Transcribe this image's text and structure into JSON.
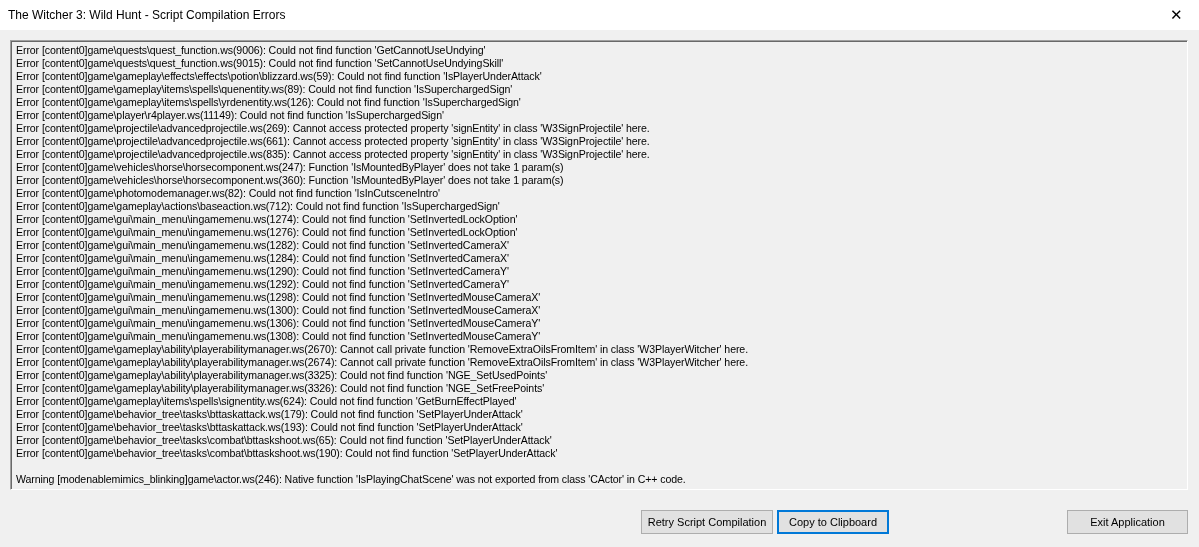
{
  "window": {
    "title": "The Witcher 3: Wild Hunt - Script Compilation Errors",
    "close": "✕"
  },
  "log": {
    "errors": [
      "Error [content0]game\\quests\\quest_function.ws(9006): Could not find function 'GetCannotUseUndying'",
      "Error [content0]game\\quests\\quest_function.ws(9015): Could not find function 'SetCannotUseUndyingSkill'",
      "Error [content0]game\\gameplay\\effects\\effects\\potion\\blizzard.ws(59): Could not find function 'IsPlayerUnderAttack'",
      "Error [content0]game\\gameplay\\items\\spells\\quenentity.ws(89): Could not find function 'IsSuperchargedSign'",
      "Error [content0]game\\gameplay\\items\\spells\\yrdenentity.ws(126): Could not find function 'IsSuperchargedSign'",
      "Error [content0]game\\player\\r4player.ws(11149): Could not find function 'IsSuperchargedSign'",
      "Error [content0]game\\projectile\\advancedprojectile.ws(269): Cannot access protected property 'signEntity' in class 'W3SignProjectile' here.",
      "Error [content0]game\\projectile\\advancedprojectile.ws(661): Cannot access protected property 'signEntity' in class 'W3SignProjectile' here.",
      "Error [content0]game\\projectile\\advancedprojectile.ws(835): Cannot access protected property 'signEntity' in class 'W3SignProjectile' here.",
      "Error [content0]game\\vehicles\\horse\\horsecomponent.ws(247): Function 'IsMountedByPlayer' does not take 1 param(s)",
      "Error [content0]game\\vehicles\\horse\\horsecomponent.ws(360): Function 'IsMountedByPlayer' does not take 1 param(s)",
      "Error [content0]game\\photomodemanager.ws(82): Could not find function 'IsInCutsceneIntro'",
      "Error [content0]game\\gameplay\\actions\\baseaction.ws(712): Could not find function 'IsSuperchargedSign'",
      "Error [content0]game\\gui\\main_menu\\ingamemenu.ws(1274): Could not find function 'SetInvertedLockOption'",
      "Error [content0]game\\gui\\main_menu\\ingamemenu.ws(1276): Could not find function 'SetInvertedLockOption'",
      "Error [content0]game\\gui\\main_menu\\ingamemenu.ws(1282): Could not find function 'SetInvertedCameraX'",
      "Error [content0]game\\gui\\main_menu\\ingamemenu.ws(1284): Could not find function 'SetInvertedCameraX'",
      "Error [content0]game\\gui\\main_menu\\ingamemenu.ws(1290): Could not find function 'SetInvertedCameraY'",
      "Error [content0]game\\gui\\main_menu\\ingamemenu.ws(1292): Could not find function 'SetInvertedCameraY'",
      "Error [content0]game\\gui\\main_menu\\ingamemenu.ws(1298): Could not find function 'SetInvertedMouseCameraX'",
      "Error [content0]game\\gui\\main_menu\\ingamemenu.ws(1300): Could not find function 'SetInvertedMouseCameraX'",
      "Error [content0]game\\gui\\main_menu\\ingamemenu.ws(1306): Could not find function 'SetInvertedMouseCameraY'",
      "Error [content0]game\\gui\\main_menu\\ingamemenu.ws(1308): Could not find function 'SetInvertedMouseCameraY'",
      "Error [content0]game\\gameplay\\ability\\playerabilitymanager.ws(2670): Cannot call private function 'RemoveExtraOilsFromItem' in class 'W3PlayerWitcher' here.",
      "Error [content0]game\\gameplay\\ability\\playerabilitymanager.ws(2674): Cannot call private function 'RemoveExtraOilsFromItem' in class 'W3PlayerWitcher' here.",
      "Error [content0]game\\gameplay\\ability\\playerabilitymanager.ws(3325): Could not find function 'NGE_SetUsedPoints'",
      "Error [content0]game\\gameplay\\ability\\playerabilitymanager.ws(3326): Could not find function 'NGE_SetFreePoints'",
      "Error [content0]game\\gameplay\\items\\spells\\signentity.ws(624): Could not find function 'GetBurnEffectPlayed'",
      "Error [content0]game\\behavior_tree\\tasks\\bttaskattack.ws(179): Could not find function 'SetPlayerUnderAttack'",
      "Error [content0]game\\behavior_tree\\tasks\\bttaskattack.ws(193): Could not find function 'SetPlayerUnderAttack'",
      "Error [content0]game\\behavior_tree\\tasks\\combat\\bttaskshoot.ws(65): Could not find function 'SetPlayerUnderAttack'",
      "Error [content0]game\\behavior_tree\\tasks\\combat\\bttaskshoot.ws(190): Could not find function 'SetPlayerUnderAttack'"
    ],
    "warnings": [
      "Warning [modenablemimics_blinking]game\\actor.ws(246): Native function 'IsPlayingChatScene' was not exported from class 'CActor' in C++ code."
    ]
  },
  "buttons": [
    {
      "label": "Retry Script Compilation",
      "default": false
    },
    {
      "label": "Copy to Clipboard",
      "default": true
    },
    {
      "label": "Exit Application",
      "default": false
    }
  ]
}
